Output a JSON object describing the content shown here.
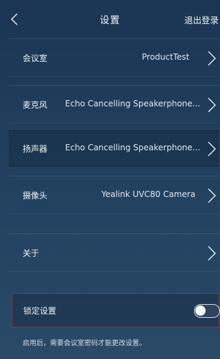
{
  "header": {
    "title": "设置",
    "logout_label": "退出登录"
  },
  "rows": [
    {
      "label": "会议室",
      "value": "ProductTest"
    },
    {
      "label": "麦克风",
      "value": "Echo Cancelling Speakerphone..."
    },
    {
      "label": "扬声器",
      "value": "Echo Cancelling Speakerphone..."
    },
    {
      "label": "摄像头",
      "value": "Yealink UVC80 Camera"
    },
    {
      "label": "关于",
      "value": ""
    }
  ],
  "lock": {
    "label": "锁定设置",
    "enabled": false,
    "hint": "启用后，需要会议室密码才能更改设置。"
  },
  "icons": {
    "back": "chevron-left-icon",
    "row_arrow": "chevron-right-icon"
  },
  "colors": {
    "background_top": "#1b3553",
    "background_bottom": "#2a4a68",
    "text": "#eef2f7",
    "lock_border": "#7a3b48"
  }
}
